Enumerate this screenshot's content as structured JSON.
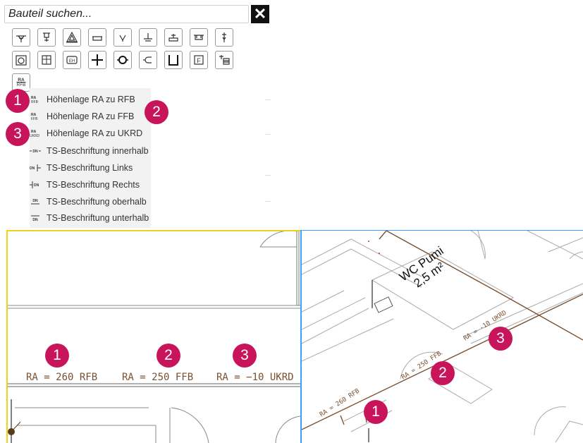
{
  "search": {
    "placeholder": "Bauteil suchen..."
  },
  "close_button": {
    "label": "✕"
  },
  "toolbar": {
    "row1_icons": [
      "gully-icon",
      "floor-drain-icon",
      "triangle-marker-icon",
      "basin-icon",
      "valve-icon",
      "pipe-connection-icon",
      "sink-icon",
      "bathtub-icon",
      "standpipe-icon"
    ],
    "row2_icons": [
      "tank-icon",
      "shaft-icon",
      "eh-element-icon",
      "cross-icon",
      "pump-icon",
      "plug-icon",
      "bracket-icon",
      "f-element-icon",
      "cabinet-icon"
    ],
    "ra_button": {
      "line1": "RA",
      "line2": "RFB"
    }
  },
  "menu": {
    "items": [
      {
        "icon": "ra-rfb-icon",
        "label": "Höhenlage RA zu RFB"
      },
      {
        "icon": "ra-ffb-icon",
        "label": "Höhenlage RA zu FFB"
      },
      {
        "icon": "ra-ukrd-icon",
        "label": "Höhenlage RA zu UKRD"
      },
      {
        "icon": "dn-inside-icon",
        "label": "TS-Beschriftung innerhalb"
      },
      {
        "icon": "dn-left-icon",
        "label": "TS-Beschriftung Links"
      },
      {
        "icon": "dn-right-icon",
        "label": "TS-Beschriftung Rechts"
      },
      {
        "icon": "dn-above-icon",
        "label": "TS-Beschriftung oberhalb"
      },
      {
        "icon": "dn-below-icon",
        "label": "TS-Beschriftung unterhalb"
      }
    ]
  },
  "badges": {
    "one": "1",
    "two": "2",
    "three": "3"
  },
  "plan2d": {
    "label_rfb": "RA = 260 RFB",
    "label_ffb": "RA = 250 FFB",
    "label_ukrd": "RA = −10 UKRD"
  },
  "plan3d": {
    "room_name": "WC Pumi",
    "room_area": "2,5 m²",
    "label_rfb": "RA = 260 RFB",
    "label_ffb": "RA = 250 FFB",
    "label_ukrd": "RA = -10 UKRD"
  },
  "colors": {
    "badge": "#c8145a",
    "label": "#7a5030",
    "pipe": "#7a5030",
    "panel_left_border": "#f0d020",
    "panel_right_border": "#3aa0ff"
  }
}
